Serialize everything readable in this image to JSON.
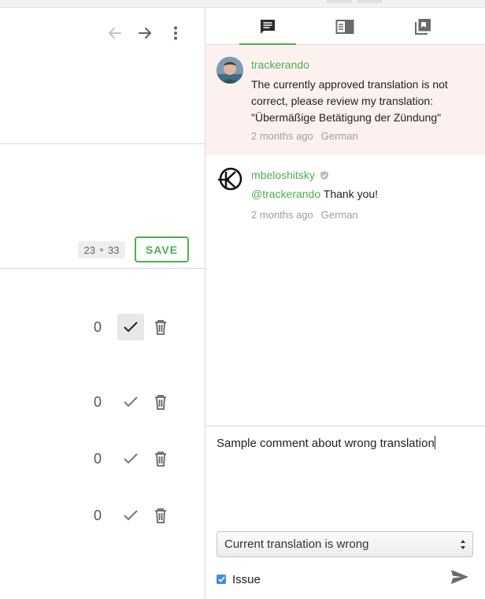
{
  "toolbar": {
    "back_icon": "arrow-left-icon",
    "forward_icon": "arrow-right-icon",
    "more_icon": "more-vertical-icon"
  },
  "editor_left": {
    "counter": {
      "current": "23",
      "total": "33"
    },
    "save_label": "SAVE"
  },
  "suggestions": [
    {
      "votes": "0",
      "approved_active": true
    },
    {
      "votes": "0",
      "approved_active": false
    },
    {
      "votes": "0",
      "approved_active": false
    },
    {
      "votes": "0",
      "approved_active": false
    }
  ],
  "tabs": [
    {
      "icon": "comments-icon",
      "active": true
    },
    {
      "icon": "machine-translation-icon",
      "active": false
    },
    {
      "icon": "translation-memory-icon",
      "active": false
    }
  ],
  "comments": [
    {
      "author": "trackerando",
      "text": "The currently approved translation is not correct, please review my translation: \"Übermäßige Betätigung der Zündung\"",
      "time": "2 months ago",
      "language": "German",
      "highlighted": true
    },
    {
      "author": "mbeloshitsky",
      "mention": "@trackerando",
      "text": " Thank you!",
      "time": "2 months ago",
      "language": "German",
      "highlighted": false
    }
  ],
  "new_comment": {
    "value": "Sample comment about wrong translation",
    "issue_type": "Current translation is wrong",
    "issue_label": "Issue",
    "issue_checked": true
  },
  "colors": {
    "accent": "#4caf50",
    "highlight_bg": "#fdf1ef",
    "checkbox": "#3d8ee6"
  }
}
